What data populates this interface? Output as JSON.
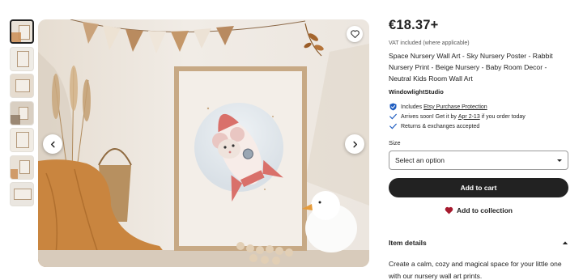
{
  "gallery": {
    "thumbnails": [
      "thumb-1",
      "thumb-2",
      "thumb-3",
      "thumb-4",
      "thumb-5",
      "thumb-6",
      "thumb-7"
    ],
    "active_index": 0
  },
  "product": {
    "price": "€18.37+",
    "vat_note": "VAT included (where applicable)",
    "title": "Space Nursery Wall Art - Sky Nursery Poster - Rabbit Nursery Print - Beige Nursery - Baby Room Decor - Neutral Kids Room Wall Art",
    "shop_name": "WindowlightStudio"
  },
  "perks": {
    "protection_prefix": "Includes",
    "protection_link": "Etsy Purchase Protection",
    "arrival_prefix": "Arrives soon! Get it by",
    "arrival_dates": "Apr 2-13",
    "arrival_suffix": "if you order today",
    "returns": "Returns & exchanges accepted"
  },
  "size": {
    "label": "Size",
    "selected": "Select an option"
  },
  "actions": {
    "add_to_cart": "Add to cart",
    "add_to_collection": "Add to collection"
  },
  "details": {
    "heading": "Item details",
    "text": "Create a calm, cozy and magical space for your little one with our nursery wall art prints."
  },
  "colors": {
    "primary_button": "#222222",
    "heart": "#a61a2e",
    "check_blue": "#1f5dc0"
  },
  "icons": {
    "favorite": "heart-outline-icon",
    "prev": "chevron-left-icon",
    "next": "chevron-right-icon",
    "protection": "shield-check-icon",
    "arrival": "check-icon",
    "returns": "check-icon",
    "dropdown": "caret-down-icon",
    "collection": "heart-filled-icon",
    "details_toggle": "chevron-up-icon"
  }
}
